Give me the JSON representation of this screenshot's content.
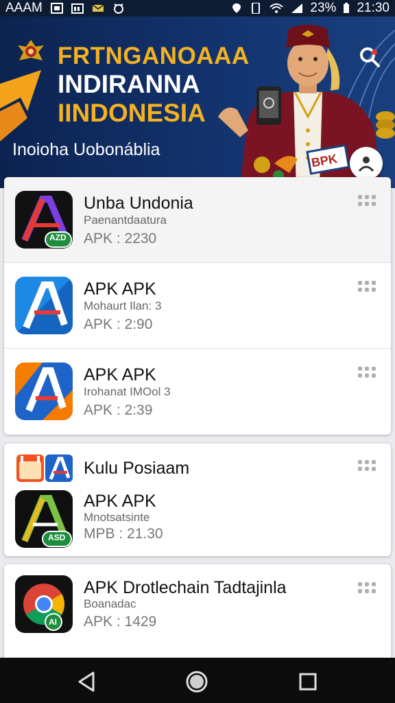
{
  "status_bar": {
    "carrier": "AAAM",
    "battery": "23%",
    "time": "21:30",
    "icons": [
      "gallery-icon",
      "calendar-icon",
      "message-icon",
      "alarm-icon",
      "location-icon",
      "phone-icon",
      "wifi-icon",
      "signal-icon",
      "battery-icon"
    ]
  },
  "banner": {
    "title_line1": "FRTNGANOAAA",
    "title_line2": "INDIRANNA",
    "title_line3": "IINDONESIA",
    "subtitle": "Inoioha Uobonáblia",
    "badge": "BPK",
    "colors": {
      "background": "#13336e",
      "accent": "#f3b221"
    },
    "icons": [
      "emblem-icon",
      "search-icon",
      "user-icon"
    ]
  },
  "cards": [
    {
      "rows": [
        {
          "name": "Unba Undonia",
          "subtitle": "Paenantdaatura",
          "version": "APK : 2230",
          "icon": "app-a-icon-dark",
          "icon_badge": "AZD",
          "highlighted": true
        },
        {
          "name": "APK APK",
          "subtitle": "Mohaurt Ilan: 3",
          "version": "APK : 2:90",
          "icon": "app-a-icon-blue"
        },
        {
          "name": "APK APK",
          "subtitle": "Irohanat IMOol 3",
          "version": "APK : 2:39",
          "icon": "app-a-icon-multicolor"
        }
      ]
    },
    {
      "header": "Kulu Posiaam",
      "rows": [
        {
          "name": "APK APK",
          "subtitle": "Mnotsatsinte",
          "version": "MPB : 21.30",
          "icon": "app-a-icon-green",
          "icon_badge": "ASD"
        }
      ]
    },
    {
      "rows": [
        {
          "name": "APK Drotlechain Tadtajinla",
          "subtitle": "Boanadac",
          "version": "APK : 1429",
          "icon": "chrome-icon",
          "icon_badge": "AI"
        }
      ]
    }
  ],
  "nav_bar": {
    "buttons": [
      "back-icon",
      "home-icon",
      "recents-icon"
    ]
  }
}
